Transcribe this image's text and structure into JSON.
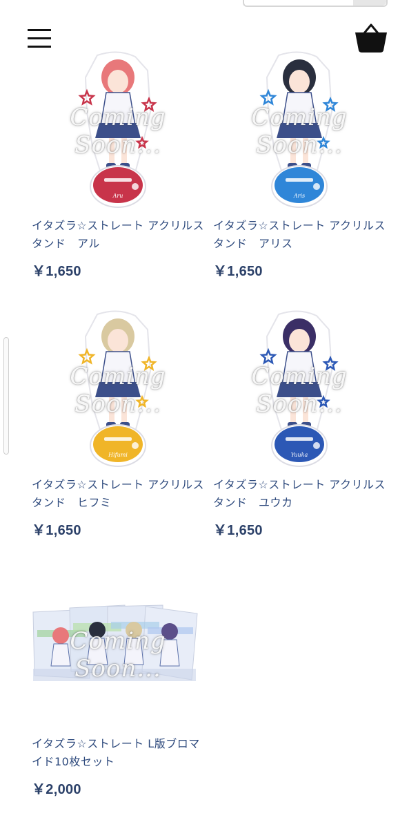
{
  "header": {
    "menu_icon": "hamburger-menu-icon",
    "cart_icon": "shopping-basket-icon"
  },
  "overlay_text": "Coming Soon...",
  "products": [
    {
      "name": "イタズラ☆ストレート アクリルスタンド　アル",
      "price": "￥1,650",
      "base_color": "#c8344a",
      "hair_color": "#e8787a",
      "nameplate": "Aru"
    },
    {
      "name": "イタズラ☆ストレート アクリルスタンド　アリス",
      "price": "￥1,650",
      "base_color": "#2f86d8",
      "hair_color": "#2a2f3e",
      "nameplate": "Aris"
    },
    {
      "name": "イタズラ☆ストレート アクリルスタンド　ヒフミ",
      "price": "￥1,650",
      "base_color": "#f0b528",
      "hair_color": "#d9c9a0",
      "nameplate": "Hifumi"
    },
    {
      "name": "イタズラ☆ストレート アクリルスタンド　ユウカ",
      "price": "￥1,650",
      "base_color": "#2c58b5",
      "hair_color": "#3b2f66",
      "nameplate": "Yuuka"
    },
    {
      "name": "イタズラ☆ストレート L版ブロマイド10枚セット",
      "price": "￥2,000",
      "base_color": "#7a9bd6",
      "hair_color": "#5c4f8a",
      "nameplate": ""
    }
  ]
}
